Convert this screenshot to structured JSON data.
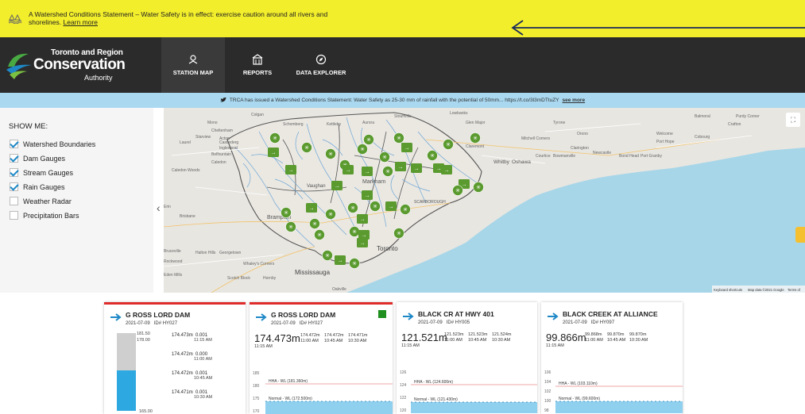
{
  "alert": {
    "message": "A Watershed Conditions Statement – Water Safety is in effect: exercise caution around all rivers and shorelines.",
    "link": "Learn more"
  },
  "brand": {
    "line1": "Toronto and Region",
    "line2": "Conservation",
    "line3": "Authority"
  },
  "nav": [
    {
      "label": "STATION MAP",
      "icon": "map-pin-icon"
    },
    {
      "label": "REPORTS",
      "icon": "building-icon"
    },
    {
      "label": "DATA EXPLORER",
      "icon": "compass-icon"
    }
  ],
  "twitter": {
    "text": "TRCA has issued a Watershed Conditions Statement: Water Safety as 25-30 mm of rainfall with the potential of 50mm... https://t.co/3l3mDTtuZY",
    "more": "see more"
  },
  "sidebar": {
    "title": "SHOW ME:",
    "options": [
      {
        "label": "Watershed Boundaries",
        "checked": true
      },
      {
        "label": "Dam Gauges",
        "checked": true
      },
      {
        "label": "Stream Gauges",
        "checked": true
      },
      {
        "label": "Rain Gauges",
        "checked": true
      },
      {
        "label": "Weather Radar",
        "checked": false
      },
      {
        "label": "Precipitation Bars",
        "checked": false
      }
    ]
  },
  "map": {
    "places": [
      "Colgan",
      "Mono",
      "Schomberg",
      "Kettleby",
      "Aurora",
      "Stouffville",
      "Lowbanks",
      "Glen Major",
      "Tyrone",
      "Balmoral",
      "Purdy Corner",
      "Welcome",
      "Cobourg",
      "Crafton",
      "Port Hope",
      "Mitchell Corners",
      "Orono",
      "Clarington",
      "Newcastle",
      "Bond Head",
      "Port Granby",
      "Whitby",
      "Oshawa",
      "Courtice",
      "Bowmanville",
      "Markham",
      "Brampton",
      "Vaughan",
      "Toronto",
      "Mississauga",
      "Caledon",
      "Starview",
      "Inglewood",
      "Erin",
      "Brisbane",
      "Bruceville",
      "Rockwood",
      "Georgetown",
      "Whaley's Corners",
      "Eden Mills",
      "Scotch Block",
      "Hornby",
      "Laurel",
      "Cheltenham",
      "Castlederg",
      "Belfountain",
      "Acton",
      "SCARBOROUGH",
      "Caledon Woods",
      "Claremont",
      "Oakville",
      "Halton Hills"
    ],
    "footer_shortcuts": "Keyboard shortcuts",
    "footer_data": "Map data ©2021 Google",
    "footer_terms": "Terms of"
  },
  "cards": [
    {
      "title": "G ROSS LORD DAM",
      "date": "2021-07-09",
      "id": "ID# HY027",
      "gauge_max": "181.50",
      "gauge_mid": "178.00",
      "gauge_min": "165.00",
      "fill_fraction": 0.52,
      "readings": [
        {
          "value": "174.473m",
          "change": "0.001",
          "time": "11:15 AM"
        },
        {
          "value": "174.472m",
          "change": "0.000",
          "time": "11:00 AM"
        },
        {
          "value": "174.472m",
          "change": "0.001",
          "time": "10:45 AM"
        },
        {
          "value": "174.471m",
          "change": "0.001",
          "time": "10:30 AM"
        }
      ]
    },
    {
      "title": "G ROSS LORD DAM",
      "date": "2021-07-09",
      "id": "ID# HY027",
      "current": "174.473m",
      "current_time": "11:15 AM",
      "recent": [
        {
          "value": "174.472m",
          "time": "11:00 AM"
        },
        {
          "value": "174.472m",
          "time": "10:45 AM"
        },
        {
          "value": "174.471m",
          "time": "10:30 AM"
        }
      ],
      "y_ticks": [
        "185",
        "180",
        "175",
        "170"
      ],
      "hha": "HHA - WL (181.360m)",
      "normal": "Normal - WL (172.500m)"
    },
    {
      "title": "BLACK CR AT HWY 401",
      "date": "2021-07-09",
      "id": "ID# HY005",
      "current": "121.521m",
      "current_time": "11:15 AM",
      "recent": [
        {
          "value": "121.523m",
          "time": "11:00 AM"
        },
        {
          "value": "121.523m",
          "time": "10:45 AM"
        },
        {
          "value": "121.524m",
          "time": "10:30 AM"
        }
      ],
      "y_ticks": [
        "126",
        "124",
        "122",
        "120"
      ],
      "hha": "HHA - WL (124.600m)",
      "normal": "Normal - WL (121.430m)"
    },
    {
      "title": "BLACK CREEK AT ALLIANCE",
      "date": "2021-07-09",
      "id": "ID# HY097",
      "current": "99.866m",
      "current_time": "11:15 AM",
      "recent": [
        {
          "value": "99.868m",
          "time": "11:00 AM"
        },
        {
          "value": "99.870m",
          "time": "10:45 AM"
        },
        {
          "value": "99.870m",
          "time": "10:30 AM"
        }
      ],
      "y_ticks": [
        "106",
        "104",
        "102",
        "100",
        "98"
      ],
      "hha": "HHA - WL (103.110m)",
      "normal": "Normal - WL (99.600m)"
    }
  ],
  "colors": {
    "alert": "#f3ee2b",
    "nav": "#2b2b2b",
    "twitter_bar": "#a9d8f0",
    "accent": "#1e88c7",
    "marker": "#5a9a2e",
    "alarm": "#e02b2b"
  }
}
